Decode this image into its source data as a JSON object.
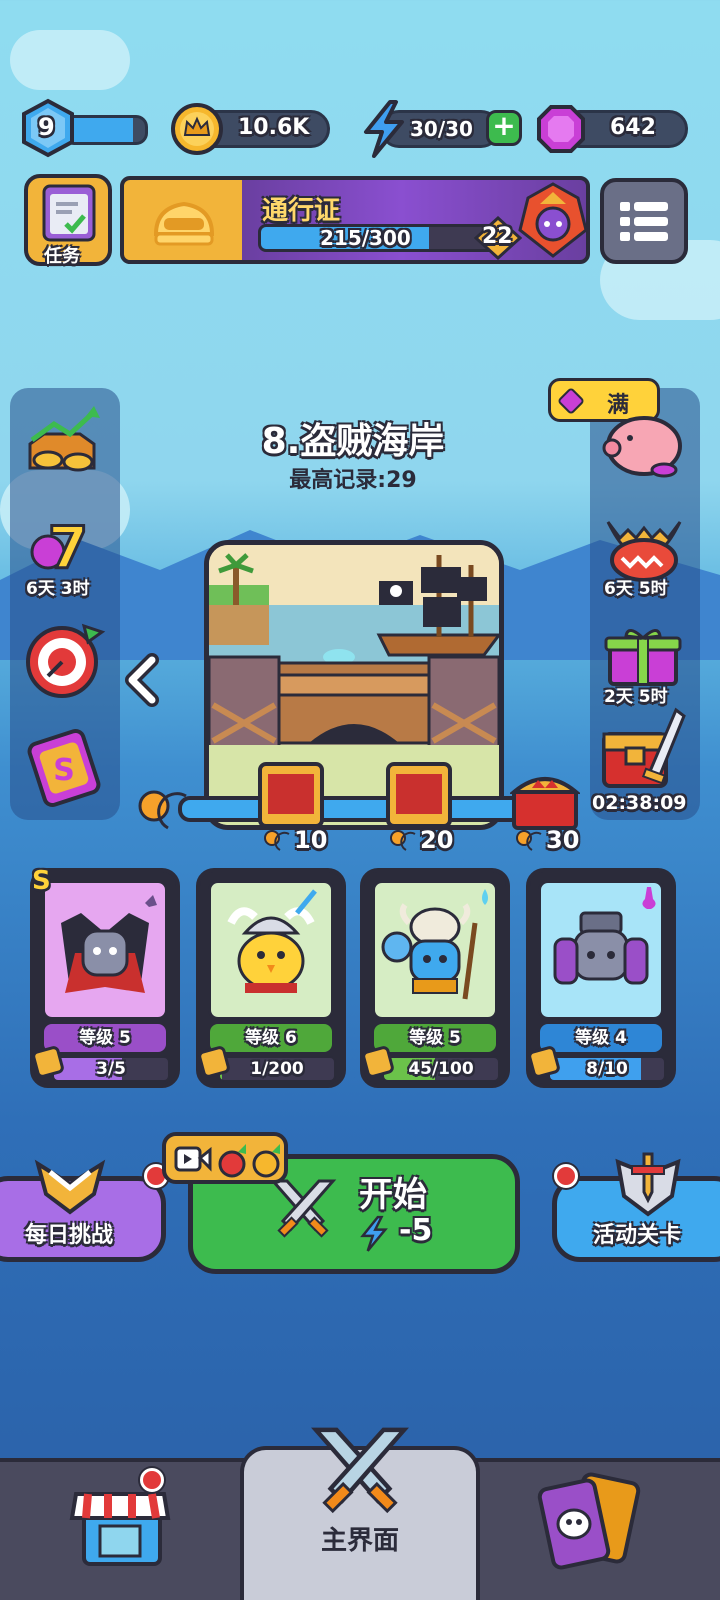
{
  "top_bar": {
    "player_level": "9",
    "level_progress": 0.85,
    "coins": "10.6K",
    "energy": "30/30",
    "gems": "642"
  },
  "banner": {
    "quest_label": "任务",
    "pass_title": "通行证",
    "pass_progress_text": "215/300",
    "pass_progress": 0.7167,
    "pass_level": "22"
  },
  "left_panel": {
    "item1_timer": "6天 3时"
  },
  "right_panel": {
    "piggy_badge": "满",
    "item2_timer": "6天 5时",
    "item3_timer": "2天 5时",
    "item4_timer": "02:38:09"
  },
  "stage": {
    "title": "8.盗贼海岸",
    "best_record": "最高记录:29",
    "milestones": [
      "10",
      "20",
      "30"
    ]
  },
  "heroes": [
    {
      "rank": "S",
      "level_label": "等级 5",
      "progress_text": "3/5",
      "progress": 0.6,
      "bg": "#e6a7f0",
      "bar": "#a86ee6",
      "lvl_bg": "#9a4fc8"
    },
    {
      "rank": "",
      "level_label": "等级 6",
      "progress_text": "1/200",
      "progress": 0.005,
      "bg": "#d6edc4",
      "bar": "#6bc24a",
      "lvl_bg": "#4fa83a"
    },
    {
      "rank": "",
      "level_label": "等级 5",
      "progress_text": "45/100",
      "progress": 0.45,
      "bg": "#d6edc4",
      "bar": "#6bc24a",
      "lvl_bg": "#4fa83a"
    },
    {
      "rank": "",
      "level_label": "等级 4",
      "progress_text": "8/10",
      "progress": 0.8,
      "bg": "#a8e4f8",
      "bar": "#3fa0ee",
      "lvl_bg": "#2e86d6"
    }
  ],
  "actions": {
    "daily_challenge": "每日挑战",
    "start_label": "开始",
    "start_cost": "-5",
    "event_stage": "活动关卡"
  },
  "bottom_nav": {
    "main_label": "主界面"
  },
  "colors": {
    "outline": "#2b2b3a",
    "gold": "#f2b43a",
    "start_green": "#3dbb4e",
    "daily_purple": "#a86ee6",
    "event_blue": "#3fa9ee"
  }
}
